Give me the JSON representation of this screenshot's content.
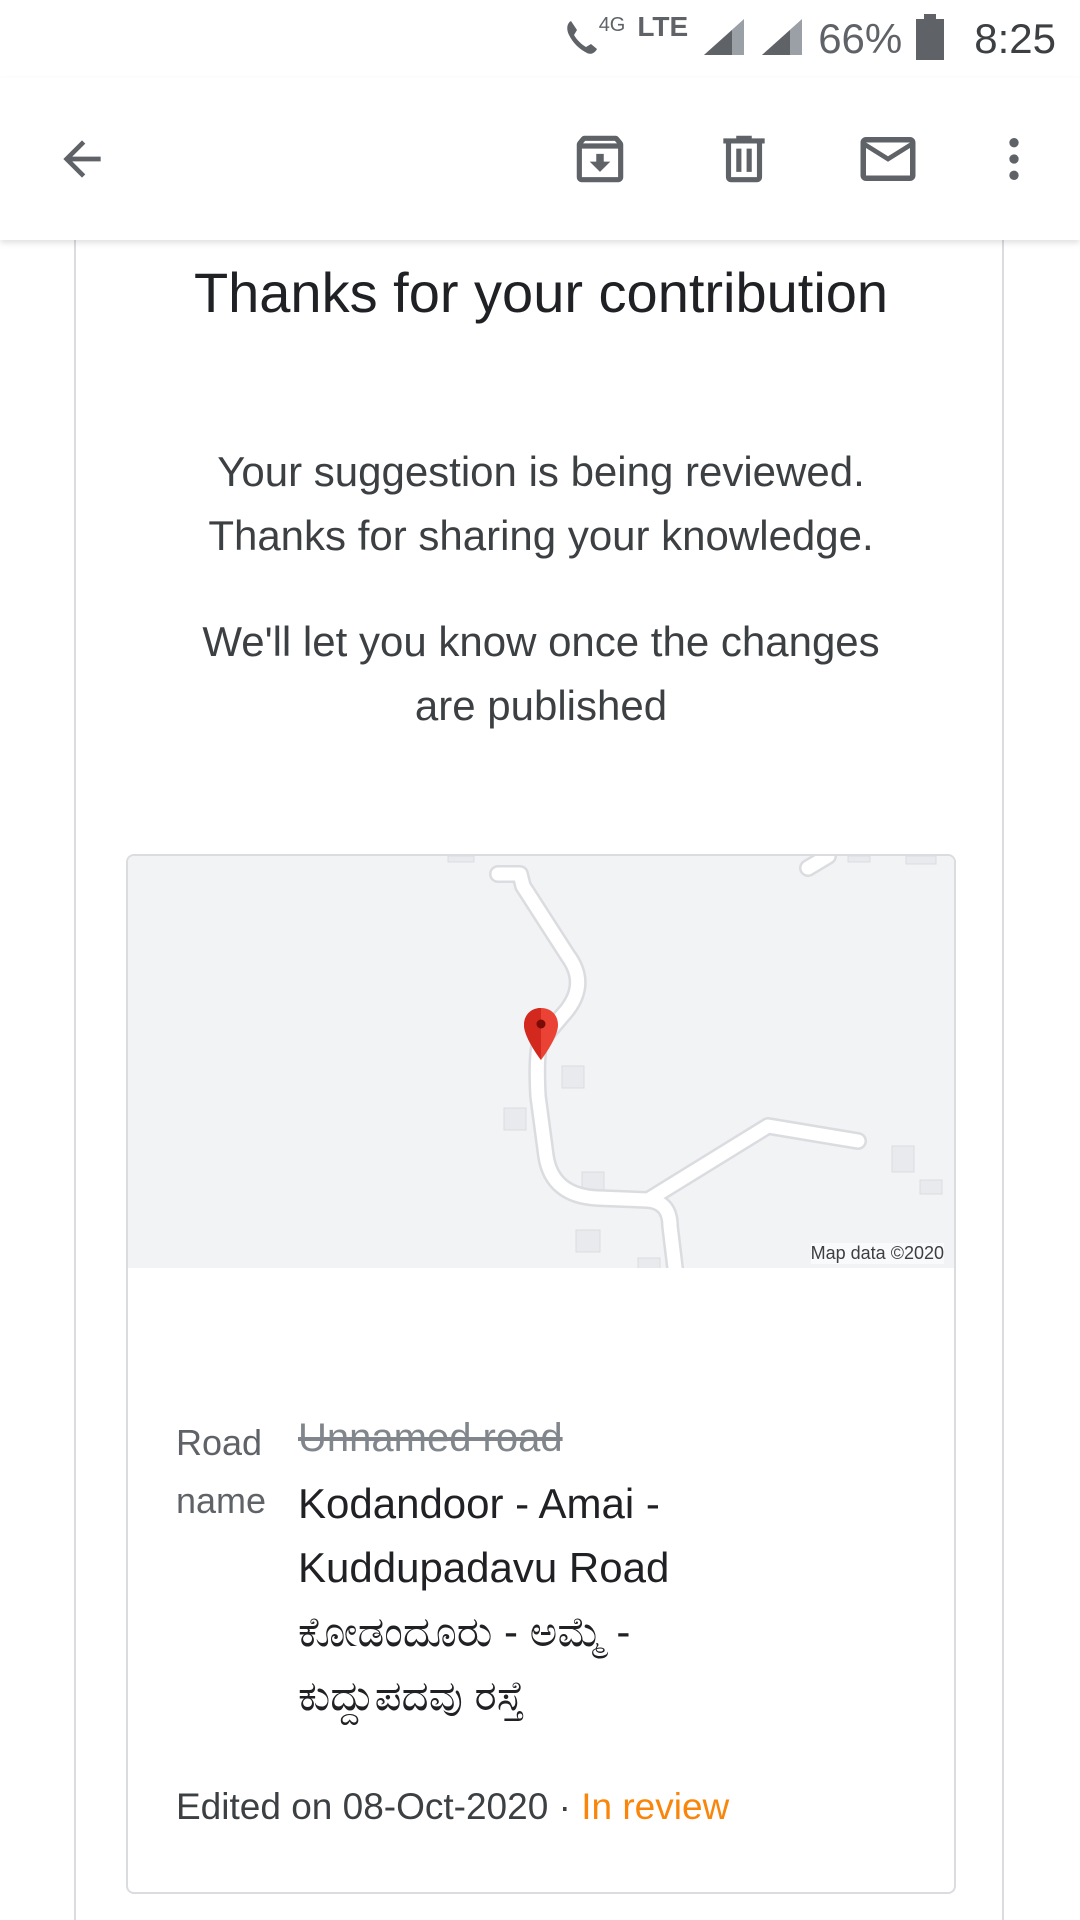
{
  "status_bar": {
    "network_label": "LTE",
    "call_label": "4G",
    "battery": "66%",
    "time": "8:25"
  },
  "toolbar": {
    "back": "arrow-left-icon",
    "archive": "archive-icon",
    "delete": "trash-icon",
    "mark_unread": "mail-icon",
    "more": "more-vert-icon"
  },
  "email": {
    "headline": "Thanks for your contribution",
    "para1_line1": "Your suggestion is being reviewed.",
    "para1_line2": "Thanks for sharing your knowledge.",
    "para2_line1": "We'll let you know once the changes",
    "para2_line2": "are published",
    "card": {
      "map_credit": "Map data ©2020",
      "field_label_line1": "Road",
      "field_label_line2": "name",
      "old_value": "Unnamed road",
      "new_value_line1": "Kodandoor - Amai -",
      "new_value_line2": "Kuddupadavu Road",
      "new_value_line3": "ಕೋಡಂದೂರು - ಅಮ್ಮೆ -",
      "new_value_line4": "ಕುದ್ದುಪದವು ರಸ್ತೆ",
      "edited_prefix": "Edited on 08-Oct-2020 · ",
      "status": "In review",
      "status_color": "#f9860b"
    }
  }
}
